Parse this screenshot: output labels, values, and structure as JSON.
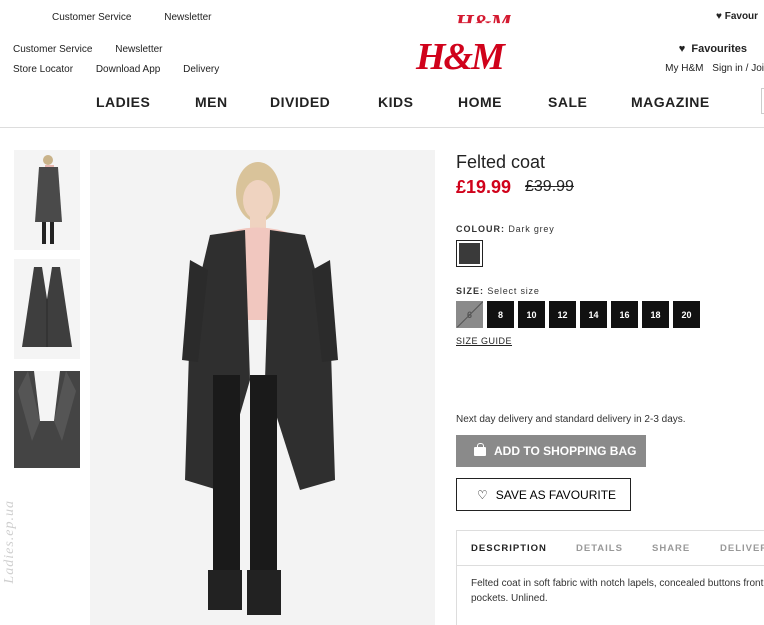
{
  "ghost_top": {
    "links": [
      "Customer Service",
      "Newsletter"
    ],
    "favourites": "Favour"
  },
  "header": {
    "util_left_row1": [
      "Customer Service",
      "Newsletter"
    ],
    "util_left_row2": [
      "Store Locator",
      "Download App",
      "Delivery"
    ],
    "logo": "H&M",
    "favourites": "Favourites",
    "my_hm": "My H&M",
    "sign_in": "Sign in / Joi"
  },
  "nav": [
    "LADIES",
    "MEN",
    "DIVIDED",
    "KIDS",
    "HOME",
    "SALE",
    "MAGAZINE"
  ],
  "product": {
    "title": "Felted coat",
    "price": "£19.99",
    "old_price": "£39.99",
    "colour_label": "COLOUR:",
    "colour_value": "Dark grey",
    "size_label": "SIZE:",
    "size_value": "Select size",
    "sizes": [
      "6",
      "8",
      "10",
      "12",
      "14",
      "16",
      "18",
      "20"
    ],
    "size_guide": "SIZE GUIDE",
    "delivery_note": "Next day delivery and standard delivery in 2-3 days.",
    "add_to_bag": "ADD TO SHOPPING BAG",
    "save_favourite": "SAVE AS FAVOURITE"
  },
  "tabs": [
    "DESCRIPTION",
    "DETAILS",
    "SHARE",
    "DELIVER"
  ],
  "description": "Felted coat in soft fabric with notch lapels, concealed buttons front pockets. Unlined.",
  "watermark": "Ladies.ep.ua",
  "colors": {
    "brand_red": "#d0021b",
    "coat": "#3a3a3a",
    "disabled": "#8a8a8a"
  }
}
